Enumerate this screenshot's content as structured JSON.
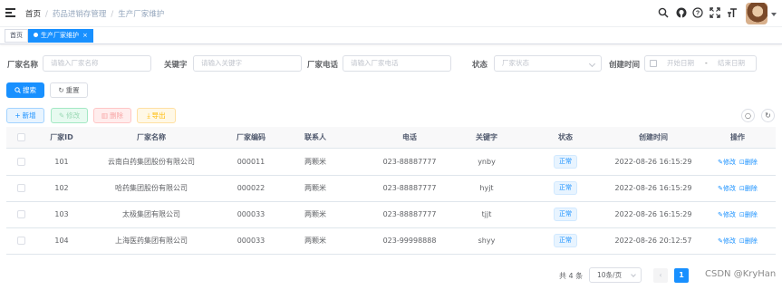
{
  "breadcrumb": [
    "首页",
    "药品进销存管理",
    "生产厂家维护"
  ],
  "tags": {
    "home": "首页",
    "active": "生产厂家维护",
    "close": "×"
  },
  "search": {
    "name_label": "厂家名称",
    "name_placeholder": "请输入厂家名称",
    "keyword_label": "关键字",
    "keyword_placeholder": "请输入关键字",
    "phone_label": "厂家电话",
    "phone_placeholder": "请输入厂家电话",
    "status_label": "状态",
    "status_placeholder": "厂家状态",
    "created_label": "创建时间",
    "start_placeholder": "开始日期",
    "range_sep": "-",
    "end_placeholder": "结束日期",
    "search_btn": "搜索",
    "reset_btn": "重置"
  },
  "toolbar": {
    "add": "新增",
    "edit": "修改",
    "delete": "删除",
    "export": "导出"
  },
  "table": {
    "headers": [
      "厂家ID",
      "厂家名称",
      "厂家编码",
      "联系人",
      "电话",
      "关键字",
      "状态",
      "创建时间",
      "操作"
    ],
    "rows": [
      {
        "id": "101",
        "name": "云南白药集团股份有限公司",
        "code": "000011",
        "contact": "两颗米",
        "phone": "023-88887777",
        "keyword": "ynby",
        "status": "正常",
        "created": "2022-08-26 16:15:29"
      },
      {
        "id": "102",
        "name": "哈药集团股份有限公司",
        "code": "000022",
        "contact": "两颗米",
        "phone": "023-88887777",
        "keyword": "hyjt",
        "status": "正常",
        "created": "2022-08-26 16:15:29"
      },
      {
        "id": "103",
        "name": "太极集团有限公司",
        "code": "000033",
        "contact": "两颗米",
        "phone": "023-88887777",
        "keyword": "tjjt",
        "status": "正常",
        "created": "2022-08-26 16:15:29"
      },
      {
        "id": "104",
        "name": "上海医药集团有限公司",
        "code": "000033",
        "contact": "两颗米",
        "phone": "023-99998888",
        "keyword": "shyy",
        "status": "正常",
        "created": "2022-08-26 20:12:57"
      }
    ],
    "op_edit": "修改",
    "op_delete": "删除"
  },
  "pagination": {
    "total": "共 4 条",
    "page_size": "10条/页",
    "current_page": "1"
  },
  "watermark": "CSDN @KryHan"
}
